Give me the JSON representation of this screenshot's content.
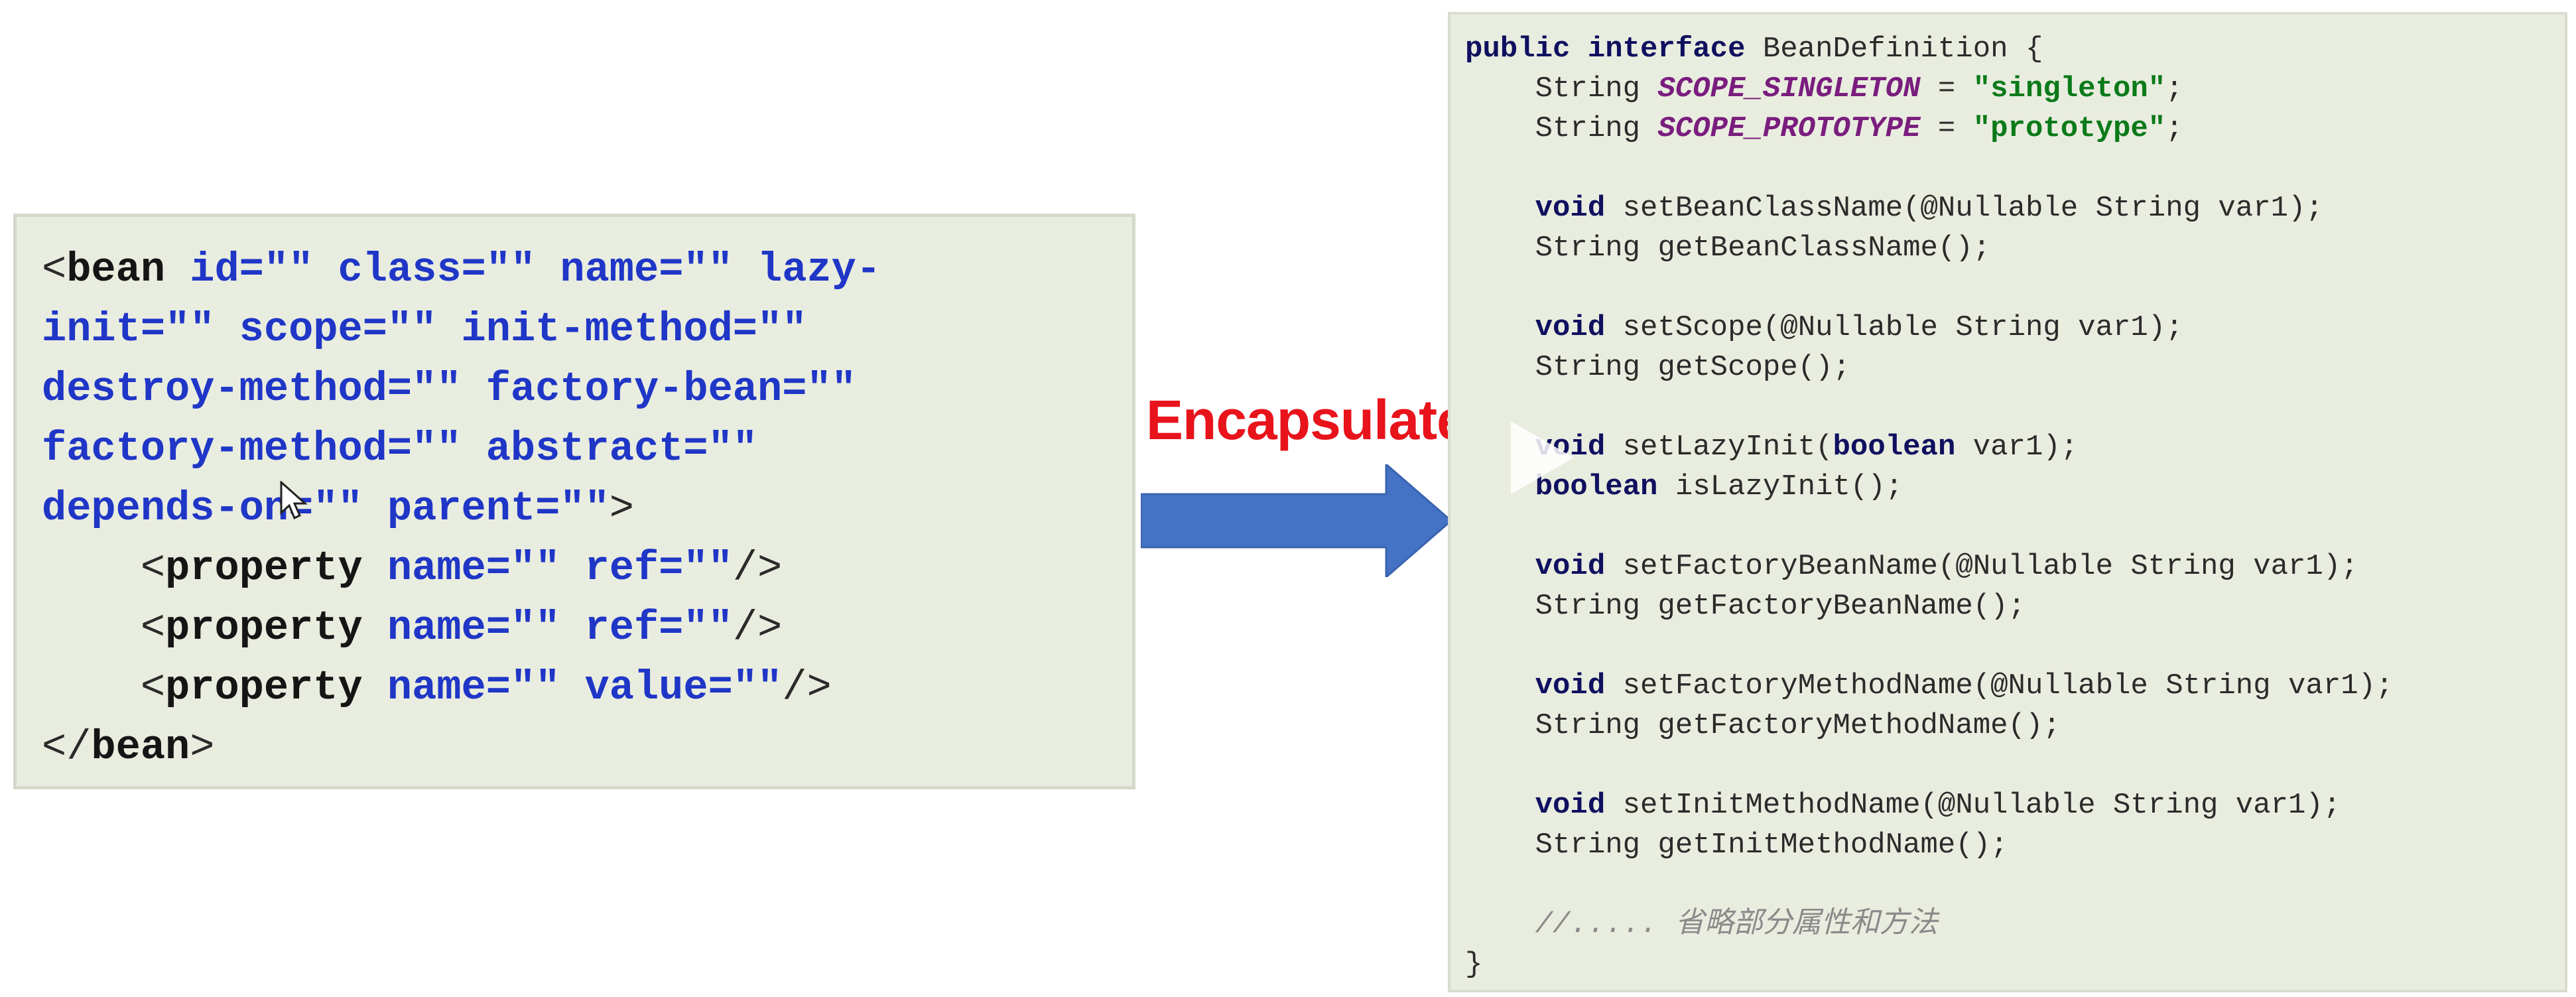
{
  "xml_block": {
    "lines": [
      [
        {
          "t": "<",
          "c": "xml-punc"
        },
        {
          "t": "bean",
          "c": "xml-tag"
        },
        {
          "t": " id=",
          "c": "xml-attr"
        },
        {
          "t": "\"\"",
          "c": "xml-str"
        },
        {
          "t": " class=",
          "c": "xml-attr"
        },
        {
          "t": "\"\"",
          "c": "xml-str"
        },
        {
          "t": " name=",
          "c": "xml-attr"
        },
        {
          "t": "\"\"",
          "c": "xml-str"
        },
        {
          "t": " lazy-",
          "c": "xml-attr"
        }
      ],
      [
        {
          "t": "init=",
          "c": "xml-attr"
        },
        {
          "t": "\"\"",
          "c": "xml-str"
        },
        {
          "t": " scope=",
          "c": "xml-attr"
        },
        {
          "t": "\"\"",
          "c": "xml-str"
        },
        {
          "t": " init-method=",
          "c": "xml-attr"
        },
        {
          "t": "\"\"",
          "c": "xml-str"
        }
      ],
      [
        {
          "t": "destroy-method=",
          "c": "xml-attr"
        },
        {
          "t": "\"\"",
          "c": "xml-str"
        },
        {
          "t": " factory-bean=",
          "c": "xml-attr"
        },
        {
          "t": "\"\"",
          "c": "xml-str"
        }
      ],
      [
        {
          "t": "factory-method=",
          "c": "xml-attr"
        },
        {
          "t": "\"\"",
          "c": "xml-str"
        },
        {
          "t": " abstract=",
          "c": "xml-attr"
        },
        {
          "t": "\"\"",
          "c": "xml-str"
        }
      ],
      [
        {
          "t": "depends-on=",
          "c": "xml-attr"
        },
        {
          "t": "\"\"",
          "c": "xml-str"
        },
        {
          "t": " parent=",
          "c": "xml-attr"
        },
        {
          "t": "\"\"",
          "c": "xml-str"
        },
        {
          "t": ">",
          "c": "xml-punc"
        }
      ],
      [
        {
          "t": "    <",
          "c": "xml-punc"
        },
        {
          "t": "property",
          "c": "xml-tag"
        },
        {
          "t": " name=",
          "c": "xml-attr"
        },
        {
          "t": "\"\"",
          "c": "xml-str"
        },
        {
          "t": " ref=",
          "c": "xml-attr"
        },
        {
          "t": "\"\"",
          "c": "xml-str"
        },
        {
          "t": "/>",
          "c": "xml-punc"
        }
      ],
      [
        {
          "t": "    <",
          "c": "xml-punc"
        },
        {
          "t": "property",
          "c": "xml-tag"
        },
        {
          "t": " name=",
          "c": "xml-attr"
        },
        {
          "t": "\"\"",
          "c": "xml-str"
        },
        {
          "t": " ref=",
          "c": "xml-attr"
        },
        {
          "t": "\"\"",
          "c": "xml-str"
        },
        {
          "t": "/>",
          "c": "xml-punc"
        }
      ],
      [
        {
          "t": "    <",
          "c": "xml-punc"
        },
        {
          "t": "property",
          "c": "xml-tag"
        },
        {
          "t": " name=",
          "c": "xml-attr"
        },
        {
          "t": "\"\"",
          "c": "xml-str"
        },
        {
          "t": " value=",
          "c": "xml-attr"
        },
        {
          "t": "\"\"",
          "c": "xml-str"
        },
        {
          "t": "/>",
          "c": "xml-punc"
        }
      ],
      [
        {
          "t": "</",
          "c": "xml-punc"
        },
        {
          "t": "bean",
          "c": "xml-tag"
        },
        {
          "t": ">",
          "c": "xml-punc"
        }
      ]
    ]
  },
  "label": "Encapsulate",
  "java_block": {
    "lines": [
      [
        {
          "t": "public interface",
          "c": "kw"
        },
        {
          "t": " BeanDefinition {",
          "c": ""
        }
      ],
      [
        {
          "t": "    String ",
          "c": ""
        },
        {
          "t": "SCOPE_SINGLETON",
          "c": "cst"
        },
        {
          "t": " = ",
          "c": ""
        },
        {
          "t": "\"singleton\"",
          "c": "str"
        },
        {
          "t": ";",
          "c": ""
        }
      ],
      [
        {
          "t": "    String ",
          "c": ""
        },
        {
          "t": "SCOPE_PROTOTYPE",
          "c": "cst"
        },
        {
          "t": " = ",
          "c": ""
        },
        {
          "t": "\"prototype\"",
          "c": "str"
        },
        {
          "t": ";",
          "c": ""
        }
      ],
      [],
      [
        {
          "t": "    ",
          "c": ""
        },
        {
          "t": "void",
          "c": "kw"
        },
        {
          "t": " setBeanClassName(@Nullable String var1);",
          "c": ""
        }
      ],
      [
        {
          "t": "    String getBeanClassName();",
          "c": ""
        }
      ],
      [],
      [
        {
          "t": "    ",
          "c": ""
        },
        {
          "t": "void",
          "c": "kw"
        },
        {
          "t": " setScope(@Nullable String var1);",
          "c": ""
        }
      ],
      [
        {
          "t": "    String getScope();",
          "c": ""
        }
      ],
      [],
      [
        {
          "t": "    ",
          "c": ""
        },
        {
          "t": "void",
          "c": "kw"
        },
        {
          "t": " setLazyInit(",
          "c": ""
        },
        {
          "t": "boolean",
          "c": "kw"
        },
        {
          "t": " var1);",
          "c": ""
        }
      ],
      [
        {
          "t": "    ",
          "c": ""
        },
        {
          "t": "boolean",
          "c": "kw"
        },
        {
          "t": " isLazyInit();",
          "c": ""
        }
      ],
      [],
      [
        {
          "t": "    ",
          "c": ""
        },
        {
          "t": "void",
          "c": "kw"
        },
        {
          "t": " setFactoryBeanName(@Nullable String var1);",
          "c": ""
        }
      ],
      [
        {
          "t": "    String getFactoryBeanName();",
          "c": ""
        }
      ],
      [],
      [
        {
          "t": "    ",
          "c": ""
        },
        {
          "t": "void",
          "c": "kw"
        },
        {
          "t": " setFactoryMethodName(@Nullable String var1);",
          "c": ""
        }
      ],
      [
        {
          "t": "    String getFactoryMethodName();",
          "c": ""
        }
      ],
      [],
      [
        {
          "t": "    ",
          "c": ""
        },
        {
          "t": "void",
          "c": "kw"
        },
        {
          "t": " setInitMethodName(@Nullable String var1);",
          "c": ""
        }
      ],
      [
        {
          "t": "    String getInitMethodName();",
          "c": ""
        }
      ],
      [],
      [
        {
          "t": "    //..... 省略部分属性和方法",
          "c": "cmt"
        }
      ],
      [
        {
          "t": "}",
          "c": ""
        }
      ]
    ]
  },
  "colors": {
    "panel_bg": "#e9eddf",
    "arrow_fill": "#4472c4",
    "label_color": "#e8131b"
  }
}
